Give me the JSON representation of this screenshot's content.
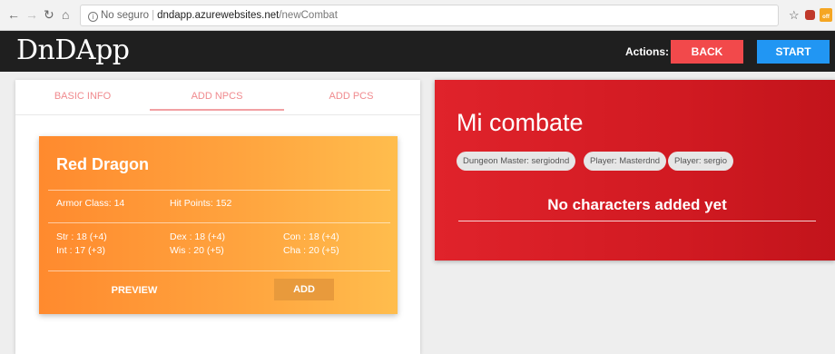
{
  "browser": {
    "security_label": "No seguro",
    "url_host": "dndapp.azurewebsites.net",
    "url_path": "/newCombat",
    "ext_off_label": "off"
  },
  "header": {
    "logo": "DnDApp",
    "actions_label": "Actions:",
    "back_label": "BACK",
    "start_label": "START"
  },
  "tabs": [
    {
      "label": "BASIC INFO"
    },
    {
      "label": "ADD NPCS"
    },
    {
      "label": "ADD PCS"
    }
  ],
  "npc_card": {
    "name": "Red Dragon",
    "armor_class": "Armor Class: 14",
    "hit_points": "Hit Points: 152",
    "str": "Str : 18 (+4)",
    "dex": "Dex : 18 (+4)",
    "con": "Con : 18 (+4)",
    "int": "Int : 17 (+3)",
    "wis": "Wis : 20 (+5)",
    "cha": "Cha : 20 (+5)",
    "preview_label": "PREVIEW",
    "add_label": "ADD"
  },
  "combat": {
    "title": "Mi combate",
    "chips": [
      "Dungeon Master: sergiodnd",
      "Player: Masterdnd",
      "Player: sergio"
    ],
    "empty_message": "No characters added yet"
  },
  "colors": {
    "header_bg": "#1f1f1f",
    "back_button": "#f2494b",
    "start_button": "#2196f3",
    "combat_panel": "#d11a22",
    "npc_card_start": "#ff8a2e",
    "npc_card_end": "#ffbd4d",
    "tab_accent": "#f08a8e"
  }
}
